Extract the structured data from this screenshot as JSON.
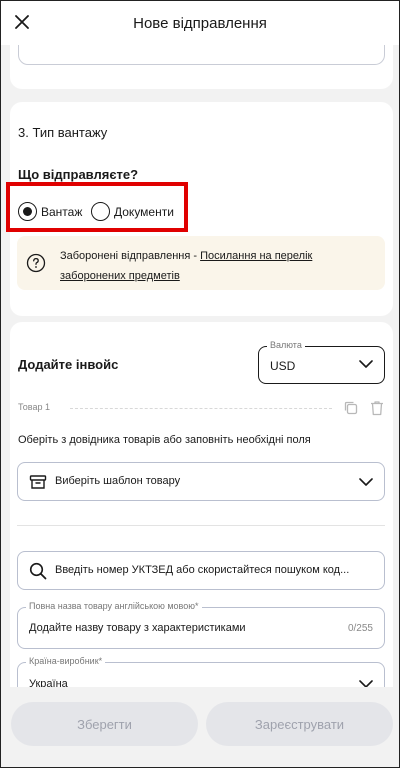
{
  "header": {
    "title": "Нове відправлення",
    "close_icon": "close-icon"
  },
  "cargo_section": {
    "title": "3. Тип вантажу",
    "question": "Що відправляєте?",
    "options": [
      {
        "label": "Вантаж",
        "selected": true
      },
      {
        "label": "Документи",
        "selected": false
      }
    ],
    "info": {
      "text": "Заборонені відправлення - ",
      "link": "Посилання на перелік заборонених предметів",
      "icon": "question-icon"
    }
  },
  "invoice_section": {
    "title": "Додайте інвойс",
    "currency": {
      "label": "Валюта",
      "value": "USD"
    },
    "item_label": "Товар 1",
    "hint": "Оберіть з довідника товарів або заповніть необхідні поля",
    "template_select": {
      "placeholder": "Виберіть шаблон товару"
    },
    "search": {
      "placeholder": "Введіть номер УКТЗЕД або скористайтеся пошуком код..."
    },
    "name_field": {
      "label": "Повна назва товару англійською мовою*",
      "placeholder": "Додайте назву товару з характеристиками",
      "counter": "0/255"
    },
    "country_field": {
      "label": "Країна-виробник*",
      "value": "Україна"
    }
  },
  "footer": {
    "save_label": "Зберегти",
    "register_label": "Зареєструвати"
  },
  "colors": {
    "highlight": "#e00000",
    "info_bg": "#faf5ea",
    "disabled_btn": "#e4e5e9"
  }
}
